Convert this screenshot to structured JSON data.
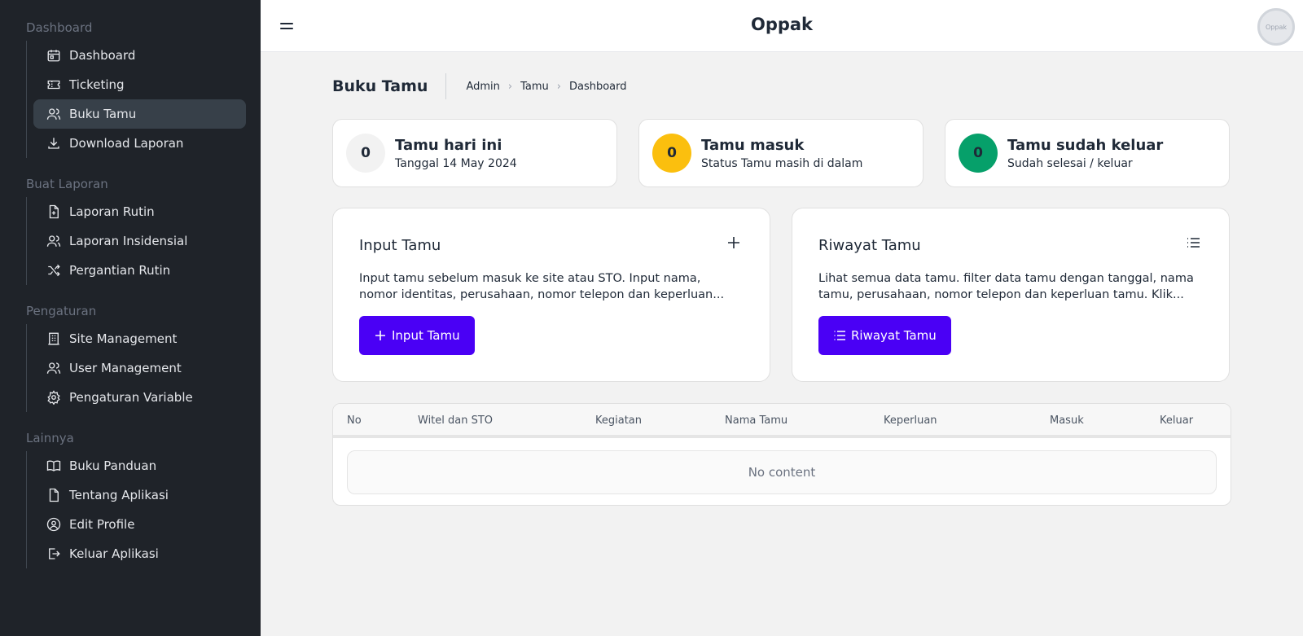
{
  "app": {
    "title": "Oppak",
    "avatar_text": "Oppak"
  },
  "sidebar": {
    "groups": [
      {
        "title": "Dashboard",
        "items": [
          {
            "label": "Dashboard",
            "icon": "calendar-icon"
          },
          {
            "label": "Ticketing",
            "icon": "ticket-icon"
          },
          {
            "label": "Buku Tamu",
            "icon": "users-icon",
            "active": true
          },
          {
            "label": "Download Laporan",
            "icon": "download-icon"
          }
        ]
      },
      {
        "title": "Buat Laporan",
        "items": [
          {
            "label": "Laporan Rutin",
            "icon": "file-plus-icon"
          },
          {
            "label": "Laporan Insidensial",
            "icon": "users-icon"
          },
          {
            "label": "Pergantian Rutin",
            "icon": "shuffle-icon"
          }
        ]
      },
      {
        "title": "Pengaturan",
        "items": [
          {
            "label": "Site Management",
            "icon": "building-icon"
          },
          {
            "label": "User Management",
            "icon": "users-icon"
          },
          {
            "label": "Pengaturan Variable",
            "icon": "gear-icon"
          }
        ]
      },
      {
        "title": "Lainnya",
        "items": [
          {
            "label": "Buku Panduan",
            "icon": "book-icon"
          },
          {
            "label": "Tentang Aplikasi",
            "icon": "file-icon"
          },
          {
            "label": "Edit Profile",
            "icon": "user-circle-icon"
          },
          {
            "label": "Keluar Aplikasi",
            "icon": "logout-icon"
          }
        ]
      }
    ]
  },
  "page": {
    "title": "Buku Tamu",
    "breadcrumb": [
      "Admin",
      "Tamu",
      "Dashboard"
    ]
  },
  "stats": [
    {
      "value": "0",
      "title": "Tamu hari ini",
      "subtitle": "Tanggal 14 May 2024",
      "color": "#f2f2f2",
      "text_color": "#1f2937"
    },
    {
      "value": "0",
      "title": "Tamu masuk",
      "subtitle": "Status Tamu masih di dalam",
      "color": "#fbbf0e",
      "text_color": "#1f2937"
    },
    {
      "value": "0",
      "title": "Tamu sudah keluar",
      "subtitle": "Sudah selesai / keluar",
      "color": "#06a06a",
      "text_color": "#1f2937"
    }
  ],
  "cards": {
    "input": {
      "title": "Input Tamu",
      "desc_line1": "Input tamu sebelum masuk ke site atau STO. Input nama,",
      "desc_line2": "nomor identitas, perusahaan, nomor telepon dan keperluan...",
      "button": "Input Tamu",
      "icon": "plus-icon"
    },
    "riwayat": {
      "title": "Riwayat Tamu",
      "desc_line1": "Lihat semua data tamu. filter data tamu dengan tanggal, nama",
      "desc_line2": "tamu, perusahaan, nomor telepon dan keperluan tamu. Klik...",
      "button": "Riwayat Tamu",
      "icon": "list-icon"
    }
  },
  "table": {
    "columns": [
      "No",
      "Witel dan STO",
      "Kegiatan",
      "Nama Tamu",
      "Keperluan",
      "Masuk",
      "Keluar"
    ],
    "empty_text": "No content"
  },
  "colors": {
    "sidebar_bg": "#1f2329",
    "accent": "#4a00f5"
  }
}
